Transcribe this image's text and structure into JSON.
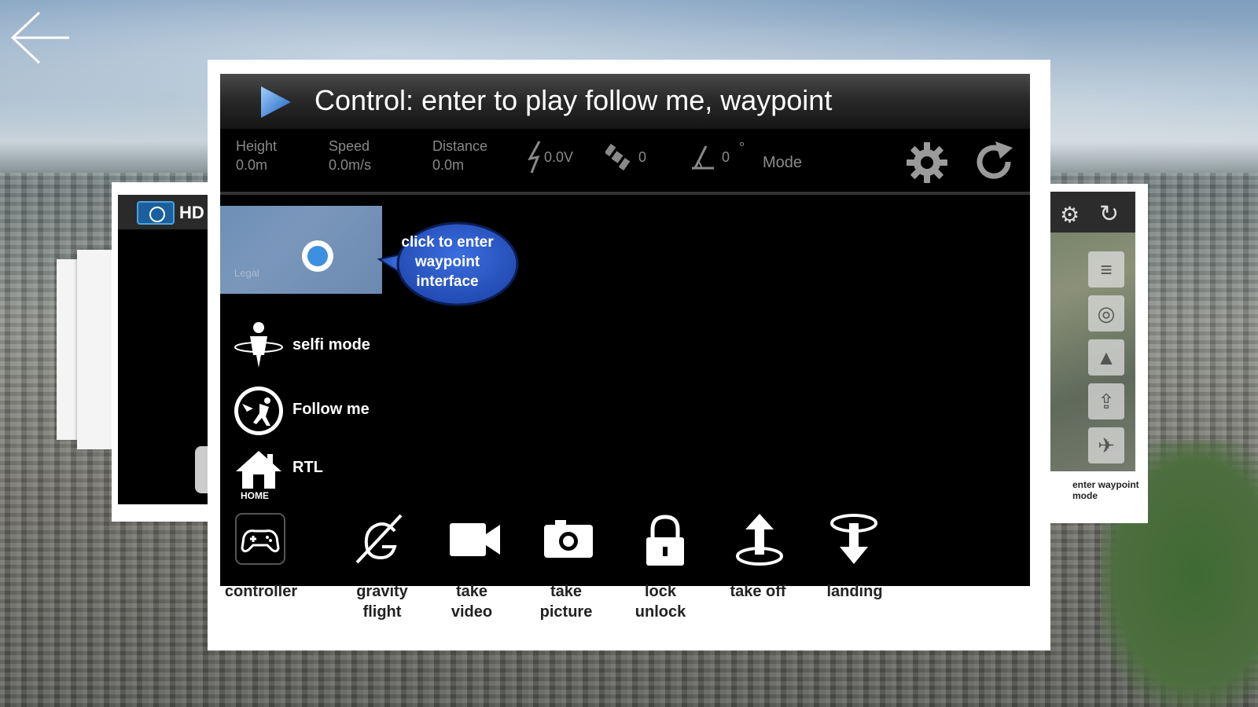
{
  "header": {
    "title": "Control: enter to play follow me, waypoint"
  },
  "status": {
    "height_label": "Height",
    "height_value": "0.0m",
    "speed_label": "Speed",
    "speed_value": "0.0m/s",
    "distance_label": "Distance",
    "distance_value": "0.0m",
    "voltage_value": "0.0V",
    "satellite_count": "0",
    "angle_value": "0",
    "angle_unit": "°",
    "mode_label": "Mode"
  },
  "map": {
    "legal_text": "Legal",
    "bubble_text": "click to enter waypoint interface"
  },
  "modes": {
    "selfie_label": "selfi mode",
    "follow_label": "Follow me",
    "rtl_label": "RTL",
    "home_text": "HOME"
  },
  "controls": {
    "controller": "controller",
    "gravity_flight": "gravity flight",
    "take_video": "take video",
    "take_picture": "take picture",
    "lock_unlock": "lock unlock",
    "take_off": "take off",
    "landing": "landing"
  },
  "side_cards": {
    "left_hd": "HD",
    "right_caption": "enter waypoint mode"
  },
  "colors": {
    "accent_blue": "#2f6fd6",
    "screen_bg": "#000000",
    "card_bg": "#ffffff"
  }
}
